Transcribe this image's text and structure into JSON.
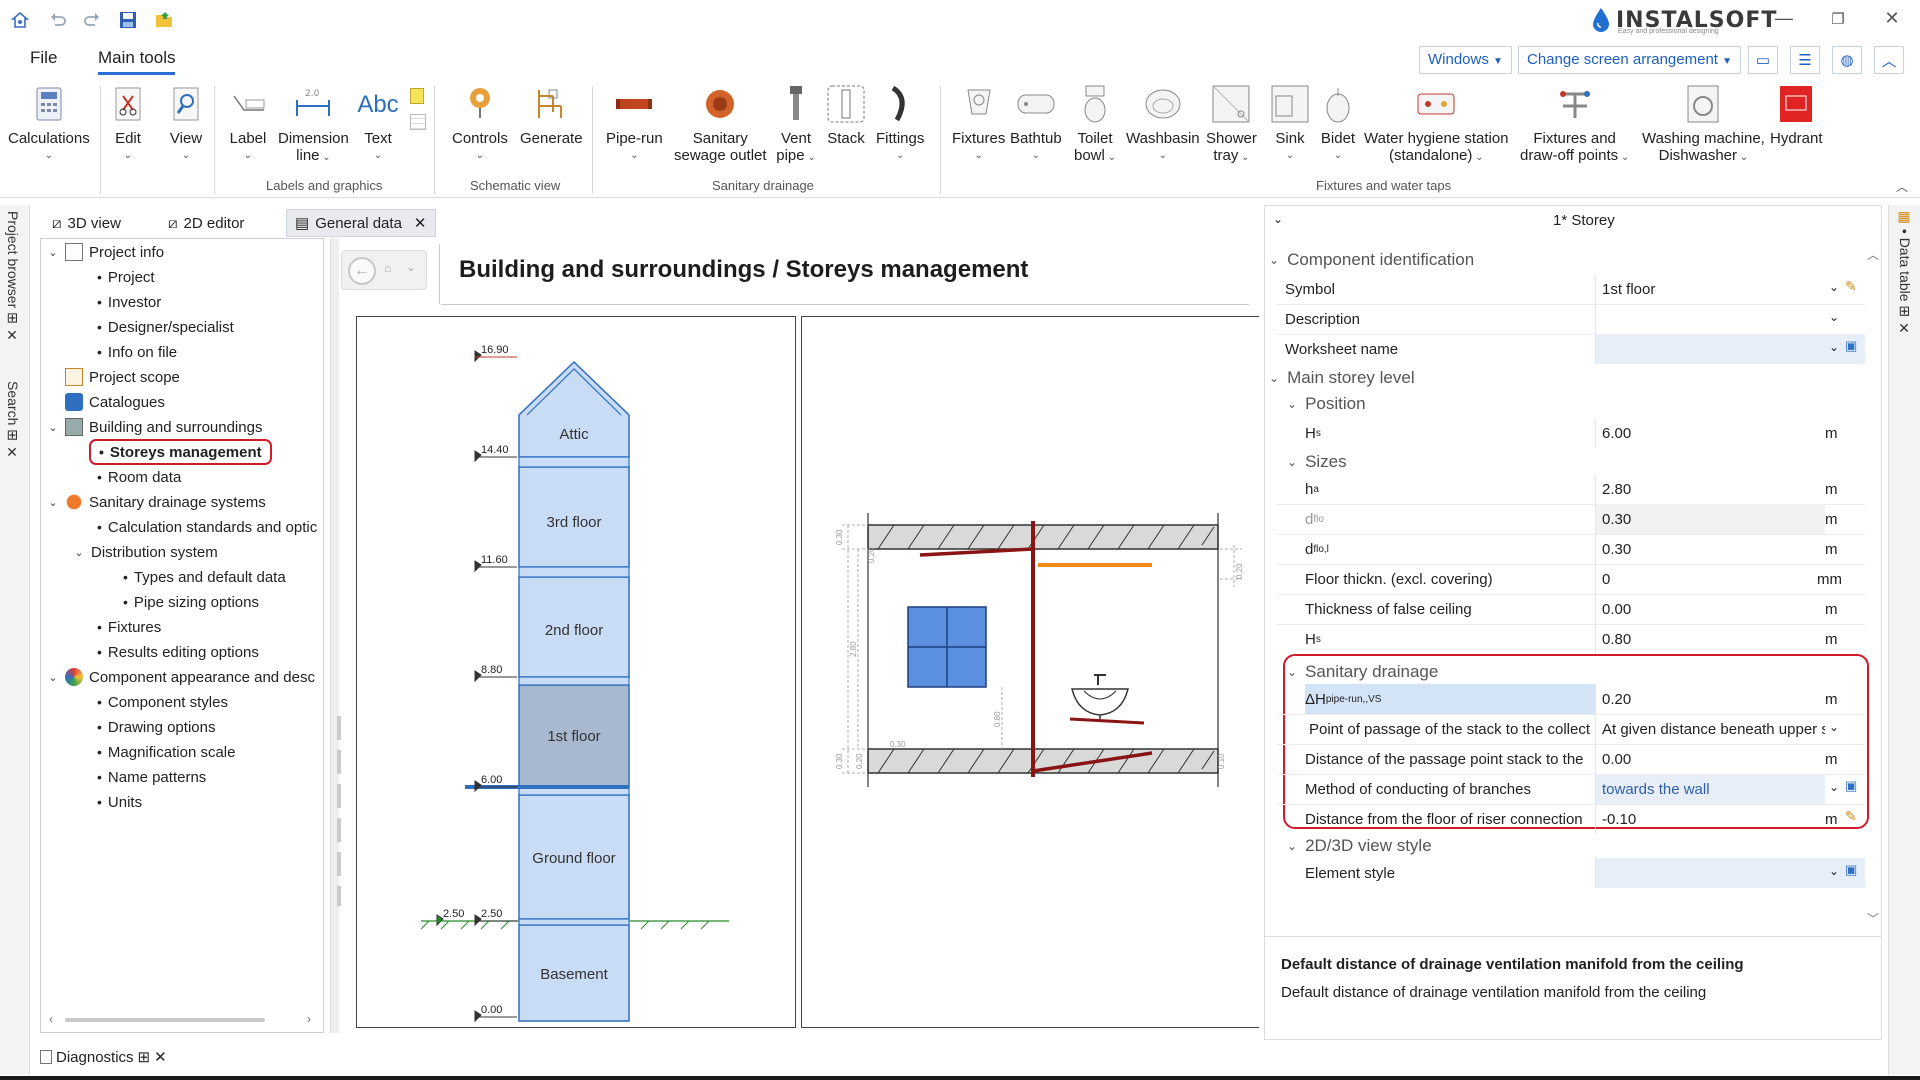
{
  "titlebar": {
    "brand": "INSTALSOFT",
    "tagline": "Easy and professional designing",
    "window_controls": [
      "minimize-icon",
      "restore-icon",
      "close-icon"
    ]
  },
  "menu": {
    "file": "File",
    "main_tools": "Main tools",
    "windows": "Windows",
    "change_screen": "Change screen arrangement"
  },
  "ribbon": {
    "calculations": "Calculations",
    "edit": "Edit",
    "view": "View",
    "label": "Label",
    "dimension": "Dimension",
    "dimension2": "line",
    "text": "Text",
    "controls": "Controls",
    "generate": "Generate",
    "pipe_run": "Pipe-run",
    "sanitary": "Sanitary",
    "sanitary2": "sewage outlet",
    "vent": "Vent",
    "vent2": "pipe",
    "stack": "Stack",
    "fittings": "Fittings",
    "fixtures": "Fixtures",
    "bathtub": "Bathtub",
    "toilet": "Toilet",
    "toilet2": "bowl",
    "washbasin": "Washbasin",
    "shower": "Shower",
    "shower2": "tray",
    "sink": "Sink",
    "bidet": "Bidet",
    "water_hygiene": "Water hygiene station",
    "water_hygiene2": "(standalone)",
    "fixtures_water": "Fixtures and",
    "fixtures_water2": "draw-off points",
    "washing": "Washing machine,",
    "washing2": "Dishwasher",
    "hydrant": "Hydrant",
    "group_labels": "Labels and graphics",
    "group_schematic": "Schematic view",
    "group_sanitary": "Sanitary drainage",
    "group_fixtures": "Fixtures and water taps"
  },
  "side_tabs": {
    "project_browser": "Project browser",
    "search": "Search",
    "data_table": "Data table",
    "diagnostics": "Diagnostics"
  },
  "doc_tabs": [
    "3D view",
    "2D editor",
    "General data"
  ],
  "tree": {
    "project_info": "Project info",
    "project": "Project",
    "investor": "Investor",
    "designer": "Designer/specialist",
    "info_on_file": "Info on file",
    "project_scope": "Project scope",
    "catalogues": "Catalogues",
    "building": "Building and surroundings",
    "storeys": "Storeys management",
    "room_data": "Room data",
    "sanitary_systems": "Sanitary drainage systems",
    "calc_standards": "Calculation standards and optic",
    "distribution": "Distribution system",
    "types_default": "Types and default data",
    "pipe_sizing": "Pipe sizing options",
    "fixtures": "Fixtures",
    "results_editing": "Results editing options",
    "component_appearance": "Component appearance and desc",
    "component_styles": "Component styles",
    "drawing_options": "Drawing options",
    "magnification": "Magnification scale",
    "name_patterns": "Name patterns",
    "units": "Units"
  },
  "page": {
    "title": "Building and surroundings / Storeys management"
  },
  "building": {
    "floors": [
      "Attic",
      "3rd floor",
      "2nd floor",
      "1st floor",
      "Ground floor",
      "Basement"
    ],
    "levels": [
      "16.90",
      "14.40",
      "11.60",
      "8.80",
      "6.00",
      "2.50",
      "2.50",
      "0.00"
    ],
    "selected": "1st floor"
  },
  "section": {
    "dims": [
      "0.30",
      "0.30",
      "2.80",
      "0.20",
      "0.80",
      "0.20",
      "0.30",
      "0.20",
      "0.10"
    ]
  },
  "props": {
    "header": "1* Storey",
    "cat_component": "Component identification",
    "symbol_label": "Symbol",
    "symbol_value": "1st floor",
    "description_label": "Description",
    "worksheet_label": "Worksheet name",
    "cat_main_level": "Main storey level",
    "cat_position": "Position",
    "hs_label": "H",
    "hs_sub": "s",
    "hs_value": "6.00",
    "cat_sizes": "Sizes",
    "ha_label": "h",
    "ha_sub": "a",
    "ha_value": "2.80",
    "dflo_label": "d",
    "dflo_sub": "flo",
    "dflo_value": "0.30",
    "dflol_label": "d",
    "dflol_sub": "flo,l",
    "dflol_value": "0.30",
    "floor_thick_label": "Floor thickn. (excl. covering)",
    "floor_thick_value": "0",
    "floor_thick_unit": "mm",
    "false_ceiling_label": "Thickness of false ceiling",
    "false_ceiling_value": "0.00",
    "hs2_label": "H",
    "hs2_sub": "s",
    "hs2_value": "0.80",
    "cat_sanitary": "Sanitary drainage",
    "dh_label": "ΔH",
    "dh_sub": "pipe-run,,VS",
    "dh_value": "0.20",
    "passage_label": "Point of passage of the stack to the collect",
    "passage_value": "At given distance beneath upper s",
    "distance_passage_label": "Distance of the passage point stack to the",
    "distance_passage_value": "0.00",
    "method_label": "Method of conducting of branches",
    "method_value": "towards the wall",
    "riser_label": "Distance from the floor of riser connection",
    "riser_value": "-0.10",
    "cat_view_style": "2D/3D view style",
    "element_style_label": "Element style",
    "unit_m": "m",
    "desc_title": "Default distance of drainage ventilation manifold from the ceiling",
    "desc_text": "Default distance of drainage ventilation manifold from the ceiling"
  },
  "colors": {
    "accent": "#2b6fd6",
    "highlight": "#d11a2a",
    "floor_fill": "#c9dcf5",
    "floor_selected": "#9fb3cc"
  }
}
